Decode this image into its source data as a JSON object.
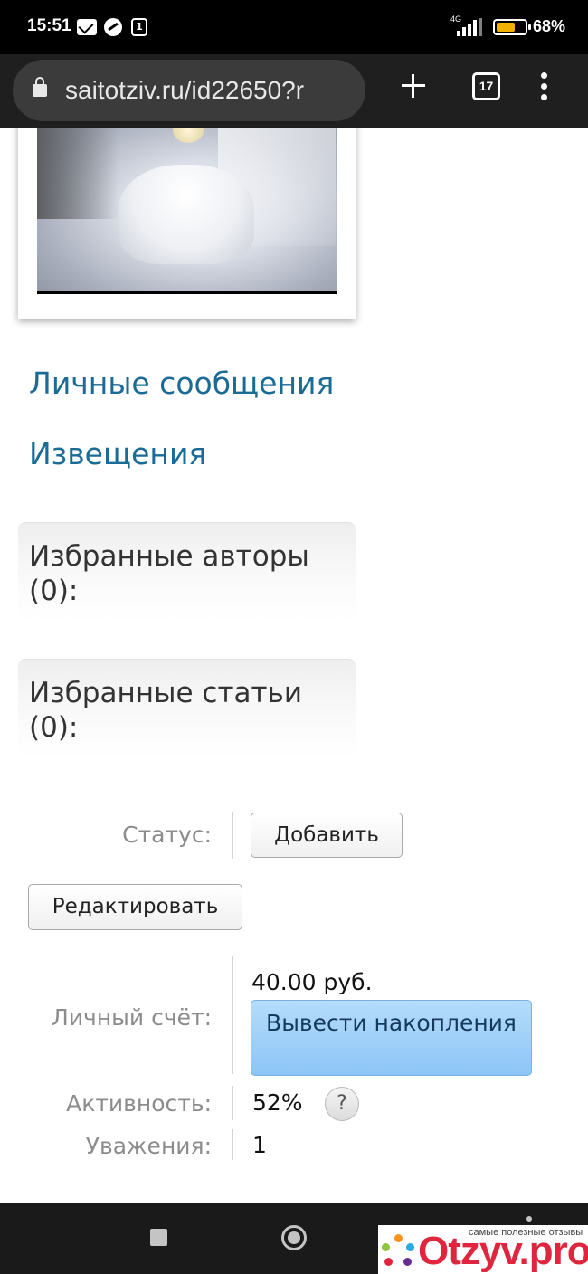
{
  "status_bar": {
    "time": "15:51",
    "network": "4G",
    "battery_percent": "68%",
    "battery_level": 0.68,
    "icons": [
      "mail-icon",
      "dnd-icon",
      "sim-icon",
      "signal-icon",
      "battery-icon"
    ]
  },
  "browser": {
    "url": "saitotziv.ru/id22650?r",
    "tab_count": "17",
    "icons": [
      "lock-icon",
      "plus-icon",
      "tabs-icon",
      "menu-icon"
    ]
  },
  "profile": {
    "links": {
      "messages": "Личные сообщения",
      "notices": "Извещения"
    },
    "favorites": {
      "authors": "Избранные авторы (0):",
      "articles": "Избранные статьи (0):"
    },
    "status": {
      "label": "Статус:",
      "add_button": "Добавить"
    },
    "edit_button": "Редактировать",
    "account": {
      "label": "Личный счёт:",
      "balance": "40.00 руб.",
      "withdraw_button": "Вывести накопления"
    },
    "activity": {
      "label": "Активность:",
      "value": "52%",
      "help": "?"
    },
    "respect": {
      "label": "Уважения:",
      "value": "1"
    }
  },
  "watermark": {
    "tagline": "самые полезные отзывы",
    "brand": "Otzyv.pro",
    "brand_color": "#e0263e"
  },
  "colors": {
    "link": "#1a6b96",
    "withdraw_button": "#8cc5f6"
  }
}
